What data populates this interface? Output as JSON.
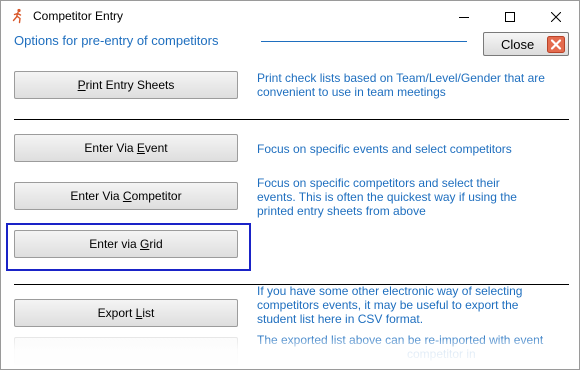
{
  "window": {
    "title": "Competitor Entry",
    "controls": {
      "minimize": "minimize",
      "maximize": "maximize",
      "close": "close"
    }
  },
  "header": {
    "title": "Options for pre-entry of competitors",
    "close_label": "Close"
  },
  "options": [
    {
      "label_pre": "",
      "label_key": "P",
      "label_post": "rint Entry Sheets",
      "description_lines": [
        "Print check lists based on Team/Level/Gender that are",
        "convenient to use in team meetings"
      ]
    },
    {
      "label_pre": "Enter Via ",
      "label_key": "E",
      "label_post": "vent",
      "description_lines": [
        "Focus on specific events and select competitors"
      ]
    },
    {
      "label_pre": "Enter Via ",
      "label_key": "C",
      "label_post": "ompetitor",
      "description_lines": [
        "Focus on specific competitors and select their",
        "events.   This is often the quickest way if using the",
        "printed entry sheets from above"
      ]
    },
    {
      "label_pre": "Enter via ",
      "label_key": "G",
      "label_post": "rid",
      "description_lines": []
    },
    {
      "label_pre": "Export ",
      "label_key": "L",
      "label_post": "ist",
      "description_lines": [
        "If you have some other electronic way of selecting",
        "competitors events, it may be useful to export the",
        "student list here in CSV format."
      ]
    },
    {
      "label_pre": "",
      "label_key": "",
      "label_post": "",
      "description_lines": [
        "The exported list above can be re-imported with event",
        "competitor in"
      ]
    }
  ],
  "colors": {
    "accent_text": "#1f6fbf",
    "highlight_border": "#1a23c7",
    "close_icon": "#d9543b"
  }
}
